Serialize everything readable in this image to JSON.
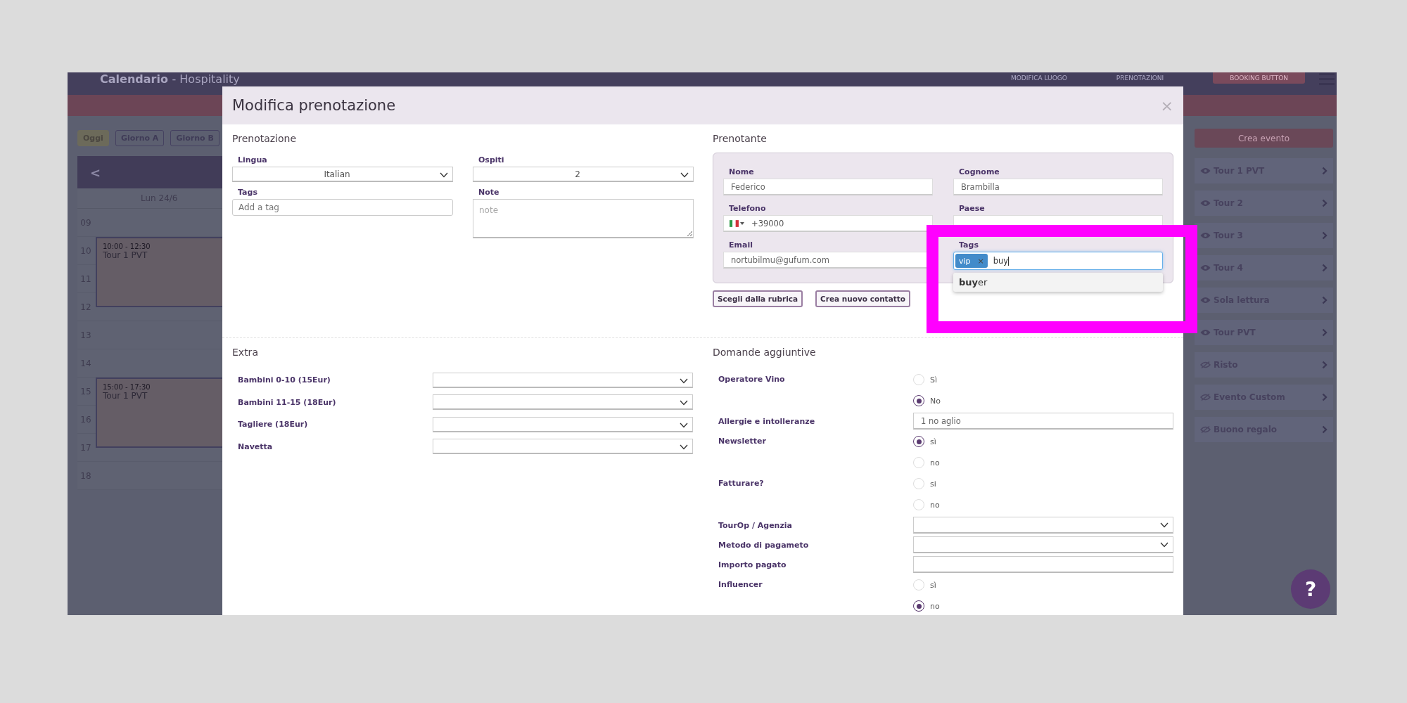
{
  "app": {
    "title": "Calendario",
    "subtitle": "- Hospitality",
    "nav": [
      "MODIFICA LUOGO",
      "PRENOTAZIONI"
    ],
    "booking_button": "BOOKING BUTTON"
  },
  "toolbar": [
    {
      "label": "Oggi",
      "selected": true
    },
    {
      "label": "Giorno A",
      "selected": false
    },
    {
      "label": "Giorno B",
      "selected": false
    }
  ],
  "calendar": {
    "prev": "<",
    "day": "Lun 24/6",
    "hours": [
      "09",
      "10",
      "11",
      "12",
      "13",
      "14",
      "15",
      "16",
      "17",
      "18"
    ],
    "events": [
      {
        "time": "10:00 - 12:30",
        "title": "Tour 1 PVT"
      },
      {
        "time": "15:00 - 17:30",
        "title": "Tour 1 PVT"
      }
    ]
  },
  "sidebar": {
    "create_button": "Crea evento",
    "items": [
      {
        "label": "Tour 1 PVT",
        "visible": true
      },
      {
        "label": "Tour 2",
        "visible": true
      },
      {
        "label": "Tour 3",
        "visible": true
      },
      {
        "label": "Tour 4",
        "visible": true
      },
      {
        "label": "Sola lettura",
        "visible": true
      },
      {
        "label": "Tour PVT",
        "visible": true
      },
      {
        "label": "Risto",
        "visible": false
      },
      {
        "label": "Evento Custom",
        "visible": false
      },
      {
        "label": "Buono regalo",
        "visible": false
      }
    ]
  },
  "help_button": "?",
  "modal": {
    "title": "Modifica prenotazione",
    "close": "×",
    "prenotazione": {
      "heading": "Prenotazione",
      "lingua": {
        "label": "Lingua",
        "value": "Italian"
      },
      "ospiti": {
        "label": "Ospiti",
        "value": "2"
      },
      "tags": {
        "label": "Tags",
        "placeholder": "Add a tag"
      },
      "note": {
        "label": "Note",
        "placeholder": "note"
      }
    },
    "prenotante": {
      "heading": "Prenotante",
      "nome": {
        "label": "Nome",
        "value": "Federico"
      },
      "cognome": {
        "label": "Cognome",
        "value": "Brambilla"
      },
      "telefono": {
        "label": "Telefono",
        "value": "+39000"
      },
      "paese": {
        "label": "Paese"
      },
      "email": {
        "label": "Email",
        "value": "nortubilmu@gufum.com"
      },
      "tags": {
        "label": "Tags",
        "chips": [
          "vip"
        ],
        "chip_remove": "×",
        "typed": "buy",
        "suggestions": [
          "**buy**er"
        ]
      },
      "buttons": [
        "Scegli dalla rubrica",
        "Crea nuovo contatto"
      ]
    },
    "extra": {
      "heading": "Extra",
      "items": [
        "Bambini 0-10 (15Eur)",
        "Bambini 11-15 (18Eur)",
        "Tagliere (18Eur)",
        "Navetta"
      ]
    },
    "domande": {
      "heading": "Domande aggiuntive",
      "questions": [
        {
          "kind": "radio",
          "label": "Operatore Vino",
          "options": [
            {
              "label": "Sì",
              "selected": false
            },
            {
              "label": "No",
              "selected": true
            }
          ]
        },
        {
          "kind": "text",
          "label": "Allergie e intolleranze",
          "value": "1 no aglio"
        },
        {
          "kind": "radio",
          "label": "Newsletter",
          "options": [
            {
              "label": "sì",
              "selected": true
            },
            {
              "label": "no",
              "selected": false
            }
          ]
        },
        {
          "kind": "radio",
          "label": "Fatturare?",
          "options": [
            {
              "label": "si",
              "selected": false
            },
            {
              "label": "no",
              "selected": false
            }
          ]
        },
        {
          "kind": "select",
          "label": "TourOp / Agenzia"
        },
        {
          "kind": "select",
          "label": "Metodo di pagameto"
        },
        {
          "kind": "text",
          "label": "Importo pagato"
        },
        {
          "kind": "radio",
          "label": "Influencer",
          "options": [
            {
              "label": "sì",
              "selected": false
            },
            {
              "label": "no",
              "selected": true
            }
          ]
        }
      ]
    }
  }
}
